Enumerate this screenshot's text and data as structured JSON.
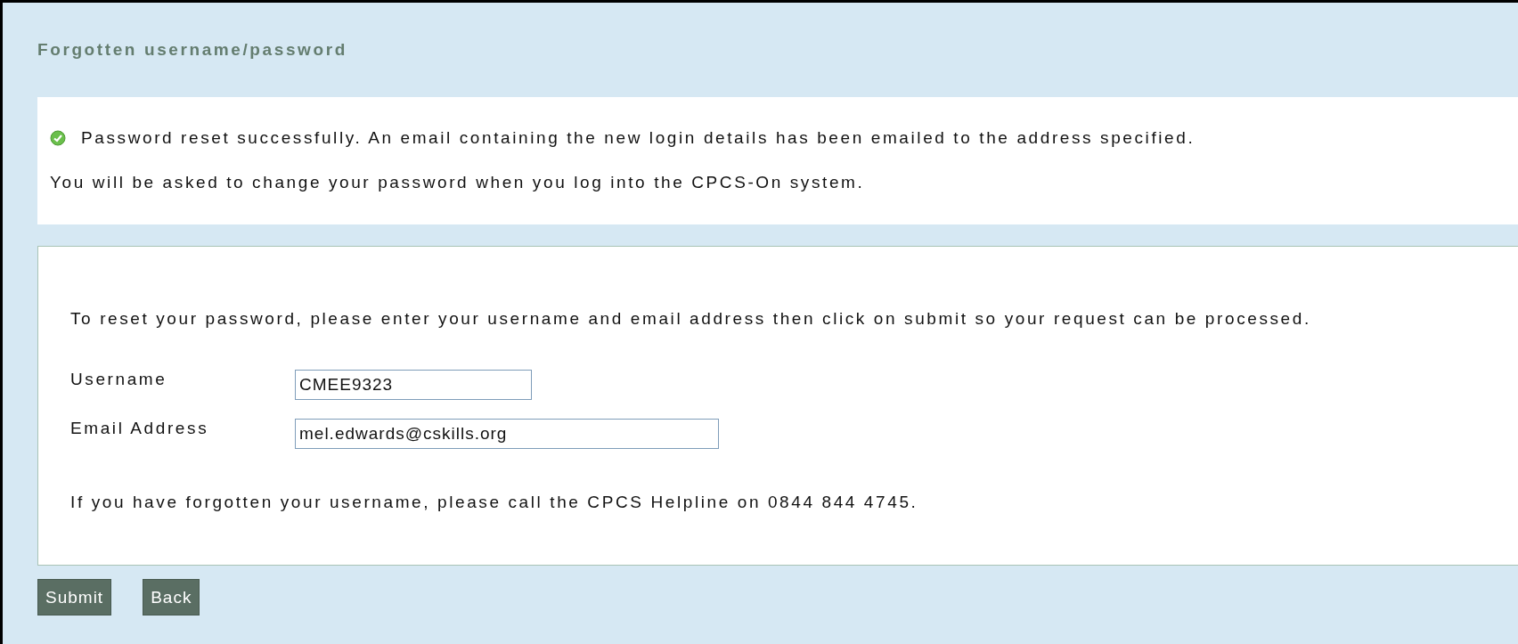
{
  "heading": "Forgotten username/password",
  "message": {
    "success": "Password reset successfully. An email containing the new login details has been emailed to the address specified.",
    "note": "You will be asked to change your password when you log into the CPCS-On system."
  },
  "form": {
    "intro": "To reset your password, please enter your username and email address then click on submit so your request can be processed.",
    "fields": [
      {
        "label": "Username",
        "value": "CMEE9323"
      },
      {
        "label": "Email Address",
        "value": "mel.edwards@cskills.org"
      }
    ],
    "help": "If you have forgotten your username, please call the CPCS Helpline on 0844 844 4745."
  },
  "buttons": [
    "Submit",
    "Back"
  ]
}
